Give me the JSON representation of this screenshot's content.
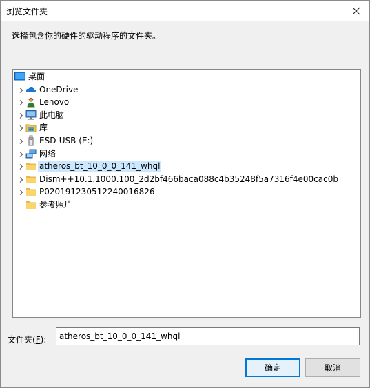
{
  "window": {
    "title": "浏览文件夹",
    "close_glyph": "✕"
  },
  "instruction": "选择包含你的硬件的驱动程序的文件夹。",
  "tree": {
    "items": [
      {
        "label": "桌面",
        "icon": "desktop-icon",
        "expandable": false,
        "selected": false
      },
      {
        "label": "OneDrive",
        "icon": "cloud-icon",
        "expandable": true,
        "selected": false
      },
      {
        "label": "Lenovo",
        "icon": "user-icon",
        "expandable": true,
        "selected": false
      },
      {
        "label": "此电脑",
        "icon": "computer-icon",
        "expandable": true,
        "selected": false
      },
      {
        "label": "库",
        "icon": "library-icon",
        "expandable": true,
        "selected": false
      },
      {
        "label": "ESD-USB (E:)",
        "icon": "usb-drive-icon",
        "expandable": true,
        "selected": false
      },
      {
        "label": "网络",
        "icon": "network-icon",
        "expandable": true,
        "selected": false
      },
      {
        "label": "atheros_bt_10_0_0_141_whql",
        "icon": "folder-icon",
        "expandable": true,
        "selected": true
      },
      {
        "label": "Dism++10.1.1000.100_2d2bf466baca088c4b35248f5a7316f4e00cac0b",
        "icon": "folder-icon",
        "expandable": true,
        "selected": false
      },
      {
        "label": "P020191230512240016826",
        "icon": "folder-icon",
        "expandable": true,
        "selected": false
      },
      {
        "label": "参考照片",
        "icon": "folder-icon",
        "expandable": false,
        "selected": false
      }
    ]
  },
  "folder_field": {
    "label": "文件夹(F):",
    "value": "atheros_bt_10_0_0_141_whql"
  },
  "buttons": {
    "ok": "确定",
    "cancel": "取消"
  },
  "colors": {
    "selection": "#cce8ff",
    "accent": "#0078d7",
    "folder": "#f5cf5b"
  }
}
